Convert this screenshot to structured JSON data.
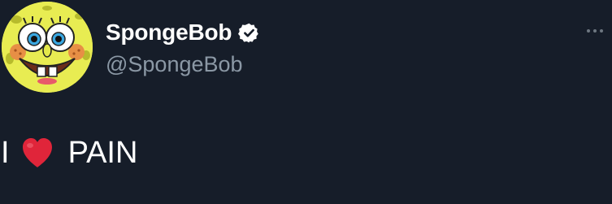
{
  "tweet": {
    "author": {
      "display_name": "SpongeBob",
      "handle": "@SpongeBob",
      "verified": true,
      "verified_icon": "verified-badge-icon",
      "avatar_icon": "spongebob-avatar"
    },
    "more_icon": "more-horizontal-icon",
    "text_before": "I",
    "emoji": "heart-emoji",
    "text_after": "PAIN"
  },
  "colors": {
    "background": "#161d29",
    "text": "#ffffff",
    "secondary_text": "#8b98a5",
    "heart": "#e0253a",
    "avatar_yellow": "#e8ec52"
  }
}
